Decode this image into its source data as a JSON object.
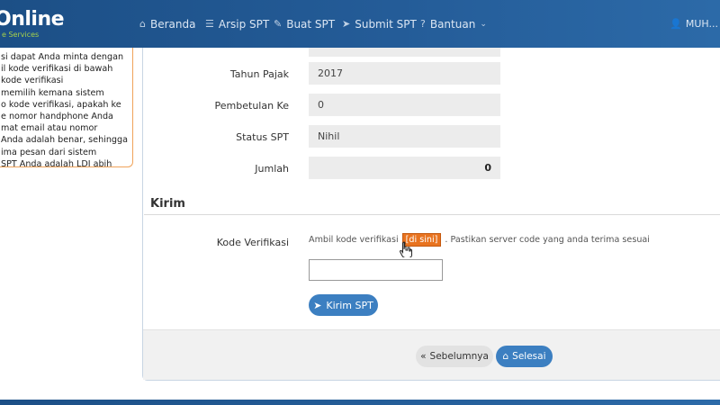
{
  "brand": {
    "title": "Online",
    "subtitle": "e Services"
  },
  "nav": {
    "items": [
      {
        "label": "Beranda",
        "icon": "home-icon"
      },
      {
        "label": "Arsip SPT",
        "icon": "list-icon"
      },
      {
        "label": "Buat SPT",
        "icon": "edit-icon"
      },
      {
        "label": "Submit SPT",
        "icon": "send-icon"
      },
      {
        "label": "Bantuan",
        "icon": "question-icon"
      }
    ],
    "user": "MUH..."
  },
  "info_lines": [
    "si dapat Anda minta dengan",
    "il kode verifikasi di bawah",
    "kode verifikasi",
    "memilih kemana sistem",
    "o kode verifikasi, apakah ke",
    "e nomor handphone Anda",
    "mat email atau nomor",
    "Anda adalah benar, sehingga",
    "ima pesan dari sistem",
    "SPT Anda adalah LDI abih"
  ],
  "form": {
    "rows": [
      {
        "label": "Tahun Pajak",
        "value": "2017"
      },
      {
        "label": "Pembetulan Ke",
        "value": "0"
      },
      {
        "label": "Status SPT",
        "value": "Nihil"
      },
      {
        "label": "Jumlah",
        "value": "0"
      }
    ]
  },
  "kirim": {
    "title": "Kirim",
    "code_label": "Kode Verifikasi",
    "hint_before": "Ambil kode verifikasi",
    "hint_link": "[di sini]",
    "hint_after": ". Pastikan server code yang anda terima sesuai",
    "code_value": "",
    "submit_label": "Kirim SPT"
  },
  "footer": {
    "prev_label": "Sebelumnya",
    "done_label": "Selesai"
  },
  "colors": {
    "nav_bg": "#245c98",
    "primary_button": "#3c7fc1",
    "link_badge": "#e8731f",
    "info_border": "#f0a35a"
  }
}
